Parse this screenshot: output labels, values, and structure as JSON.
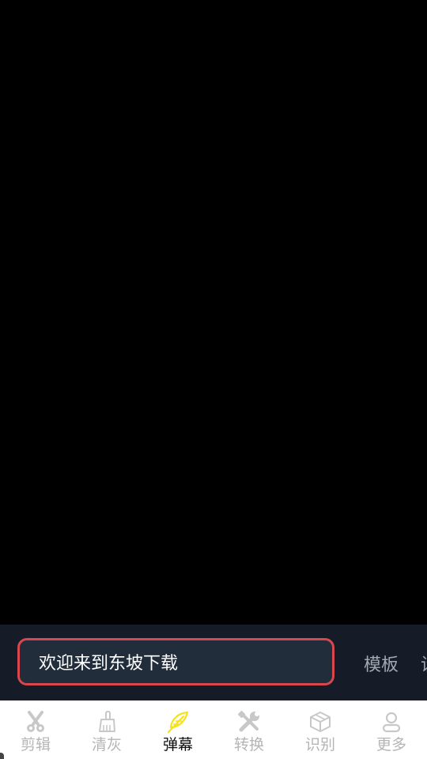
{
  "input_bar": {
    "text": "欢迎来到东坡下载",
    "template_label": "模板",
    "settings_label": "设"
  },
  "tabs": [
    {
      "label": "剪辑",
      "icon": "scissors-icon",
      "active": false
    },
    {
      "label": "清灰",
      "icon": "brush-icon",
      "active": false
    },
    {
      "label": "弹幕",
      "icon": "feather-icon",
      "active": true
    },
    {
      "label": "转换",
      "icon": "wrench-icon",
      "active": false
    },
    {
      "label": "识别",
      "icon": "cube-icon",
      "active": false
    },
    {
      "label": "更多",
      "icon": "user-icon",
      "active": false
    }
  ],
  "colors": {
    "accent": "#f5e11c",
    "input_border": "#d7474d",
    "inactive": "#c8c8c8"
  }
}
